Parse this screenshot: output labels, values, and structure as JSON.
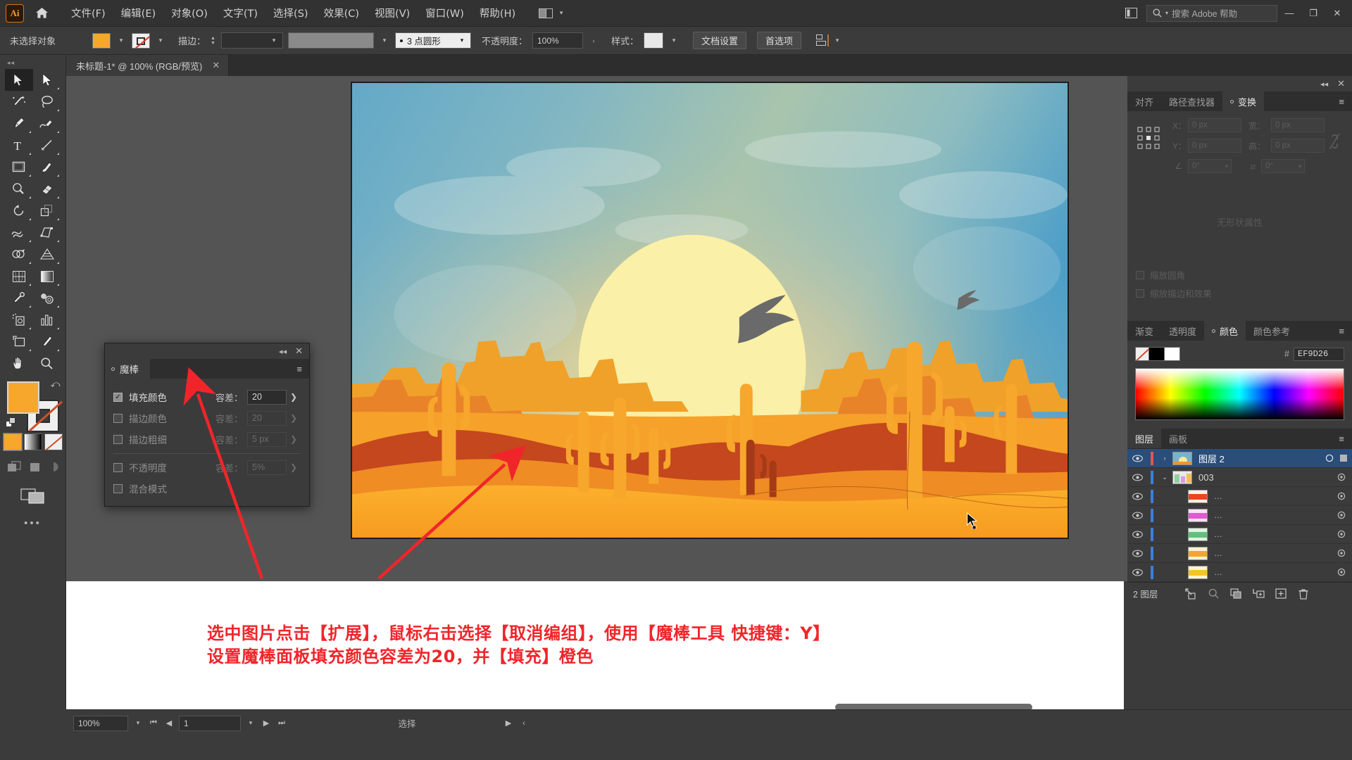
{
  "app": {
    "logo_text": "Ai",
    "menu": [
      {
        "label": "文件(F)"
      },
      {
        "label": "编辑(E)"
      },
      {
        "label": "对象(O)"
      },
      {
        "label": "文字(T)"
      },
      {
        "label": "选择(S)"
      },
      {
        "label": "效果(C)"
      },
      {
        "label": "视图(V)"
      },
      {
        "label": "窗口(W)"
      },
      {
        "label": "帮助(H)"
      }
    ],
    "search_placeholder": "搜索 Adobe 帮助",
    "window_controls": {
      "minimize": "—",
      "maximize": "❐",
      "close": "✕"
    }
  },
  "control_bar": {
    "selection_status": "未选择对象",
    "stroke_label": "描边：",
    "stroke_weight": "",
    "stroke_profile": "",
    "stroke_style": "3 点圆形",
    "opacity_label": "不透明度：",
    "opacity_value": "100%",
    "style_label": "样式：",
    "doc_setup_button": "文档设置",
    "preferences_button": "首选项"
  },
  "document_tab": {
    "title": "未标题-1* @ 100% (RGB/预览)",
    "close": "✕"
  },
  "toolbar": {
    "tools": [
      {
        "name": "selection-tool",
        "active": true
      },
      {
        "name": "direct-selection-tool",
        "active": false
      },
      {
        "name": "magic-wand-tool",
        "active": false
      },
      {
        "name": "lasso-tool",
        "active": false
      },
      {
        "name": "pen-tool",
        "active": false
      },
      {
        "name": "curvature-tool",
        "active": false
      },
      {
        "name": "type-tool",
        "active": false
      },
      {
        "name": "line-segment-tool",
        "active": false
      },
      {
        "name": "rectangle-tool",
        "active": false
      },
      {
        "name": "paintbrush-tool",
        "active": false
      },
      {
        "name": "shaper-tool",
        "active": false
      },
      {
        "name": "eraser-tool",
        "active": false
      },
      {
        "name": "rotate-tool",
        "active": false
      },
      {
        "name": "scale-tool",
        "active": false
      },
      {
        "name": "width-tool",
        "active": false
      },
      {
        "name": "free-transform-tool",
        "active": false
      },
      {
        "name": "shape-builder-tool",
        "active": false
      },
      {
        "name": "perspective-grid-tool",
        "active": false
      },
      {
        "name": "mesh-tool",
        "active": false
      },
      {
        "name": "gradient-tool",
        "active": false
      },
      {
        "name": "eyedropper-tool",
        "active": false
      },
      {
        "name": "blend-tool",
        "active": false
      },
      {
        "name": "symbol-sprayer-tool",
        "active": false
      },
      {
        "name": "column-graph-tool",
        "active": false
      },
      {
        "name": "artboard-tool",
        "active": false
      },
      {
        "name": "slice-tool",
        "active": false
      },
      {
        "name": "hand-tool",
        "active": false
      },
      {
        "name": "zoom-tool",
        "active": false
      }
    ],
    "fill_color": "#F7A72B",
    "stroke_color": "#EFEFEF",
    "more_tools": "•••"
  },
  "magic_wand_panel": {
    "title": "魔棒",
    "collapse": "◂◂",
    "close": "✕",
    "menu": "≡",
    "rows": [
      {
        "label": "填充颜色",
        "checked": true,
        "tol_label": "容差：",
        "value": "20",
        "enabled": true
      },
      {
        "label": "描边颜色",
        "checked": false,
        "tol_label": "容差：",
        "value": "20",
        "enabled": false
      },
      {
        "label": "描边粗细",
        "checked": false,
        "tol_label": "容差：",
        "value": "5 px",
        "enabled": false
      },
      {
        "label": "不透明度",
        "checked": false,
        "tol_label": "容差：",
        "value": "5%",
        "enabled": false
      },
      {
        "label": "混合模式",
        "checked": false,
        "tol_label": "",
        "value": "",
        "enabled": false
      }
    ]
  },
  "right_dock": {
    "transform": {
      "tabs": [
        {
          "label": "对齐",
          "active": false
        },
        {
          "label": "路径查找器",
          "active": false
        },
        {
          "label": "变换",
          "active": true
        }
      ],
      "menu": "≡",
      "fields": [
        {
          "label": "X：",
          "value": "0 px"
        },
        {
          "label": "宽：",
          "value": "0 px"
        },
        {
          "label": "Y：",
          "value": "0 px"
        },
        {
          "label": "高：",
          "value": "0 px"
        }
      ],
      "angle_value": "0°",
      "shear_value": "0°",
      "no_attributes": "无形状属性",
      "checkboxes": [
        {
          "label": "缩放圆角"
        },
        {
          "label": "缩放描边和效果"
        }
      ]
    },
    "color": {
      "tabs": [
        {
          "label": "渐变",
          "active": false
        },
        {
          "label": "透明度",
          "active": false
        },
        {
          "label": "颜色",
          "active": true
        },
        {
          "label": "颜色参考",
          "active": false
        }
      ],
      "menu": "≡",
      "hash": "#",
      "hex_value": "EF9D26"
    },
    "layers": {
      "tabs": [
        {
          "label": "图层",
          "active": true
        },
        {
          "label": "画板",
          "active": false
        }
      ],
      "menu": "≡",
      "rows": [
        {
          "name": "图层 2",
          "selected": true,
          "indent": 0,
          "bar": "#e2564c",
          "twirl": "›",
          "thumb": [
            "#7cb3c9",
            "#f5a834",
            "#e8732a"
          ]
        },
        {
          "name": "003",
          "selected": false,
          "indent": 0,
          "bar": "#3b7fe0",
          "twirl": "⌄",
          "thumb": [
            "#d6d6d6",
            "#7fc08a",
            "#c59be0"
          ]
        },
        {
          "name": "…",
          "selected": false,
          "indent": 1,
          "bar": "#3b7fe0",
          "twirl": "",
          "thumb": [
            "#ffffff",
            "#e8481f",
            "#fde6c8"
          ]
        },
        {
          "name": "…",
          "selected": false,
          "indent": 1,
          "bar": "#3b7fe0",
          "twirl": "",
          "thumb": [
            "#ffffff",
            "#e05ad0",
            "#fbe2f7"
          ]
        },
        {
          "name": "…",
          "selected": false,
          "indent": 1,
          "bar": "#3b7fe0",
          "twirl": "",
          "thumb": [
            "#ffffff",
            "#63bf7d",
            "#e0f3e4"
          ]
        },
        {
          "name": "…",
          "selected": false,
          "indent": 1,
          "bar": "#3b7fe0",
          "twirl": "",
          "thumb": [
            "#ffffff",
            "#f2a62c",
            "#fdf0d8"
          ]
        },
        {
          "name": "…",
          "selected": false,
          "indent": 1,
          "bar": "#3b7fe0",
          "twirl": "",
          "thumb": [
            "#ffffff",
            "#f5c623",
            "#fdf4cf"
          ]
        }
      ],
      "footer": {
        "count": "2 图层",
        "icons": [
          "locate-object-icon",
          "search-icon",
          "make-clipping-mask-icon",
          "create-sublayer-icon",
          "create-new-layer-icon",
          "delete-layer-icon"
        ]
      }
    }
  },
  "status_bar": {
    "zoom": "100%",
    "page": "1",
    "tool": "选择",
    "nav_first": "⏮",
    "nav_prev": "◀",
    "nav_next": "▶",
    "nav_last": "⏭",
    "expand": "▶",
    "collapse": "‹"
  },
  "caption": {
    "line1": "选中图片点击【扩展】，鼠标右击选择【取消编组】，使用【魔棒工具 快捷键：Y】",
    "line2": "设置魔棒面板填充颜色容差为20，并【填充】橙色",
    "color": "#F0252A"
  },
  "artwork": {
    "title": "沙漠日落仙人掌插画",
    "palette": {
      "sky_top": "#5aa8c8",
      "sky_mid": "#9ec4b8",
      "sun": "#fcf0ab",
      "sand": "#f9a524",
      "dune_dark": "#c6491c",
      "rock_orange": "#ef8222",
      "cactus": "#f7a72b",
      "bird": "#6a6a6a"
    }
  }
}
